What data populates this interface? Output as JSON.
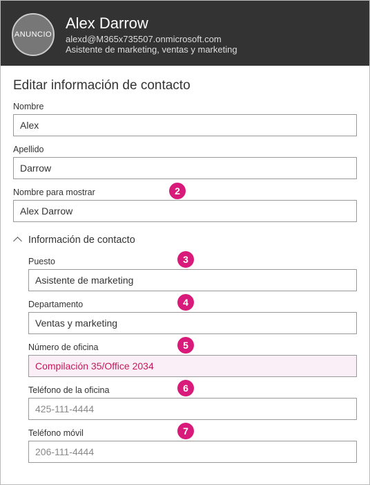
{
  "header": {
    "avatar_text": "ANUNCIO",
    "name": "Alex Darrow",
    "email": "alexd@M365x735507.onmicrosoft.com",
    "role": "Asistente de marketing, ventas y marketing"
  },
  "page": {
    "title": "Editar información de contacto"
  },
  "fields": {
    "first_name": {
      "label": "Nombre",
      "value": "Alex"
    },
    "last_name": {
      "label": "Apellido",
      "value": "Darrow"
    },
    "display_name": {
      "label": "Nombre para mostrar",
      "value": "Alex Darrow",
      "badge": "2"
    }
  },
  "contact_section": {
    "title": "Información de contacto",
    "fields": {
      "job_title": {
        "label": "Puesto",
        "value": "Asistente de marketing",
        "badge": "3"
      },
      "department": {
        "label": "Departamento",
        "value": "Ventas y marketing",
        "badge": "4"
      },
      "office_number": {
        "label": "Número de oficina",
        "value": "Compilación 35/Office 2034",
        "badge": "5"
      },
      "office_phone": {
        "label": "Teléfono de la oficina",
        "value": "425-111-4444",
        "badge": "6"
      },
      "mobile_phone": {
        "label": "Teléfono móvil",
        "value": "206-111-4444",
        "badge": "7"
      }
    }
  }
}
